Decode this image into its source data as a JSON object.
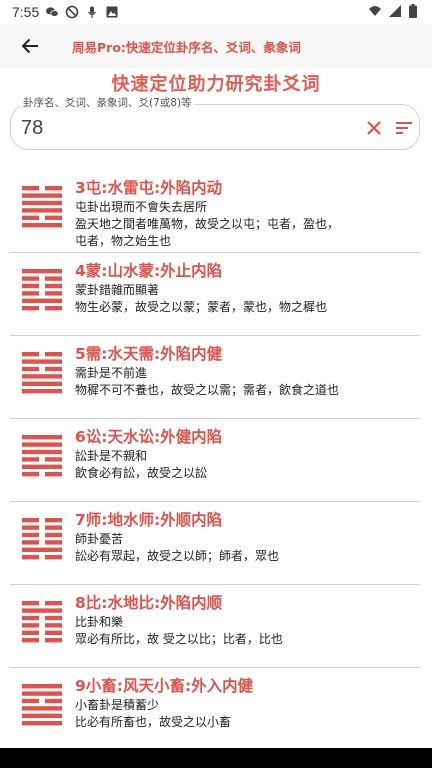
{
  "status": {
    "time": "7:55"
  },
  "appbar": {
    "title": "周易Pro:快速定位卦序名、爻词、彖象词"
  },
  "heading": "快速定位助力研究卦爻词",
  "search": {
    "label": "卦序名、爻词、彖象词、爻(7或8)等",
    "value": "78"
  },
  "colors": {
    "accent": "#e0534c"
  },
  "items": [
    {
      "name": "3屯:水雷屯:外陷内动",
      "lines": [
        "屯卦出現而不會失去居所",
        "盈天地之間者唯萬物，故受之以屯；屯者，盈也，",
        "屯者，物之始生也"
      ],
      "hex": [
        0,
        1,
        1,
        1,
        0,
        1
      ]
    },
    {
      "name": "4蒙:山水蒙:外止内陷",
      "lines": [
        "蒙卦錯雜而顯著",
        "物生必蒙，故受之以蒙；蒙者，蒙也，物之穉也",
        ""
      ],
      "hex": [
        1,
        0,
        0,
        0,
        1,
        0
      ]
    },
    {
      "name": "5需:水天需:外陷内健",
      "lines": [
        "需卦是不前進",
        "物穉不可不養也，故受之以需；需者，飲食之道也",
        ""
      ],
      "hex": [
        0,
        1,
        0,
        1,
        1,
        1
      ]
    },
    {
      "name": "6讼:天水讼:外健内陷",
      "lines": [
        "訟卦是不親和",
        "飲食必有訟，故受之以訟",
        ""
      ],
      "hex": [
        1,
        1,
        1,
        0,
        1,
        0
      ]
    },
    {
      "name": "7师:地水师:外顺内陷",
      "lines": [
        "師卦憂苦",
        "訟必有眾起，故受之以師；師者，眾也",
        ""
      ],
      "hex": [
        0,
        0,
        0,
        0,
        1,
        0
      ]
    },
    {
      "name": "8比:水地比:外陷内顺",
      "lines": [
        "比卦和樂",
        "眾必有所比，故 受之以比；比者，比也",
        ""
      ],
      "hex": [
        0,
        1,
        0,
        0,
        0,
        0
      ]
    },
    {
      "name": "9小畜:风天小畜:外入内健",
      "lines": [
        "小畜卦是積蓄少",
        "比必有所畜也，故受之以小畜",
        ""
      ],
      "hex": [
        1,
        1,
        0,
        1,
        1,
        1
      ]
    }
  ]
}
